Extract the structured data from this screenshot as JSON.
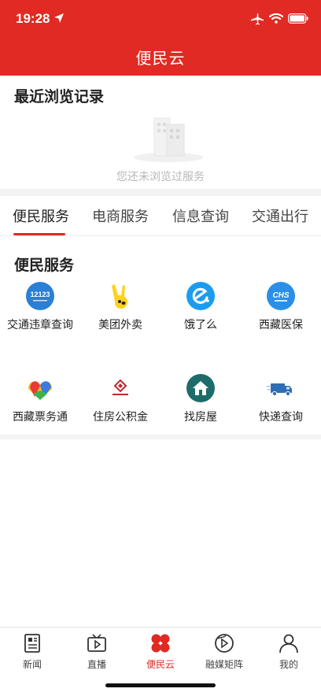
{
  "status": {
    "time": "19:28"
  },
  "header": {
    "title": "便民云"
  },
  "recent": {
    "title": "最近浏览记录",
    "empty_text": "您还未浏览过服务"
  },
  "tabs": [
    {
      "label": "便民服务"
    },
    {
      "label": "电商服务"
    },
    {
      "label": "信息查询"
    },
    {
      "label": "交通出行"
    }
  ],
  "services": {
    "title": "便民服务",
    "items": [
      {
        "label": "交通违章查询",
        "icon": "traffic-12123-icon",
        "icon_text": "12123"
      },
      {
        "label": "美团外卖",
        "icon": "meituan-kangaroo-icon"
      },
      {
        "label": "饿了么",
        "icon": "eleme-icon"
      },
      {
        "label": "西藏医保",
        "icon": "chs-medical-insurance-icon",
        "icon_text": "CHS"
      },
      {
        "label": "西藏票务通",
        "icon": "ticket-service-icon"
      },
      {
        "label": "住房公积金",
        "icon": "housing-fund-icon"
      },
      {
        "label": "找房屋",
        "icon": "house-icon"
      },
      {
        "label": "快递查询",
        "icon": "delivery-truck-icon"
      }
    ]
  },
  "tabbar": [
    {
      "label": "新闻",
      "icon": "newspaper-icon"
    },
    {
      "label": "直播",
      "icon": "tv-play-icon"
    },
    {
      "label": "便民云",
      "icon": "four-petal-icon"
    },
    {
      "label": "融媒矩阵",
      "icon": "media-matrix-icon"
    },
    {
      "label": "我的",
      "icon": "person-icon"
    }
  ],
  "colors": {
    "accent": "#e02a23",
    "blue": "#2d8ff0",
    "teal": "#1f6e6e"
  }
}
